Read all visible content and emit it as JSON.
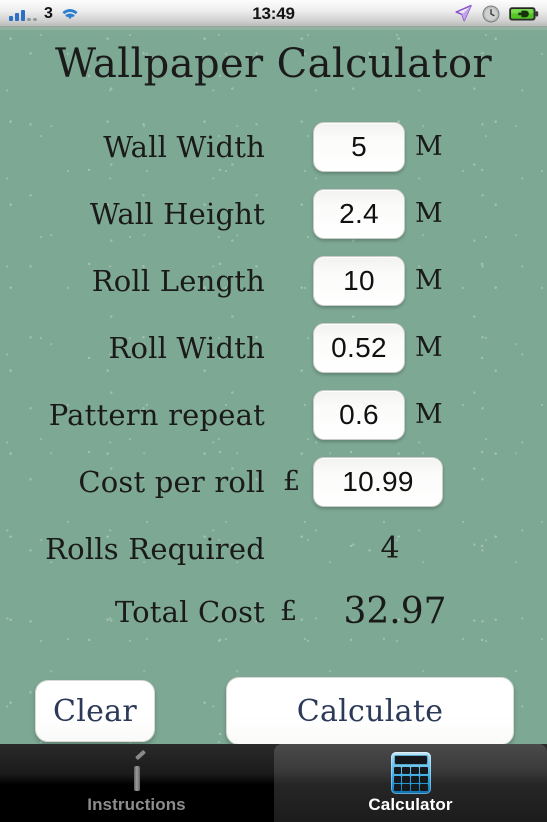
{
  "status_bar": {
    "carrier": "3",
    "time": "13:49",
    "signal_icon": "signal-bars-icon",
    "wifi_icon": "wifi-icon",
    "location_icon": "location-arrow-icon",
    "alarm_icon": "alarm-clock-icon",
    "battery_icon": "battery-charging-icon"
  },
  "app": {
    "title": "Wallpaper Calculator",
    "background_color": "#7da894",
    "text_color": "#1a1a1a",
    "button_text_color": "#2c3a58"
  },
  "form": {
    "rows": [
      {
        "label": "Wall Width",
        "value": "5",
        "unit": "M"
      },
      {
        "label": "Wall Height",
        "value": "2.4",
        "unit": "M"
      },
      {
        "label": "Roll Length",
        "value": "10",
        "unit": "M"
      },
      {
        "label": "Roll Width",
        "value": "0.52",
        "unit": "M"
      },
      {
        "label": "Pattern repeat",
        "value": "0.6",
        "unit": "M"
      },
      {
        "label": "Cost per roll",
        "value": "10.99",
        "currency": "£"
      }
    ]
  },
  "results": {
    "rolls_required_label": "Rolls Required",
    "rolls_required_value": "4",
    "total_cost_label": "Total Cost",
    "total_cost_currency": "£",
    "total_cost_value": "32.97"
  },
  "buttons": {
    "clear": "Clear",
    "calculate": "Calculate"
  },
  "tab_bar": {
    "tabs": [
      {
        "label": "Instructions",
        "icon": "pen-icon",
        "active": false
      },
      {
        "label": "Calculator",
        "icon": "calculator-icon",
        "active": true
      }
    ]
  }
}
